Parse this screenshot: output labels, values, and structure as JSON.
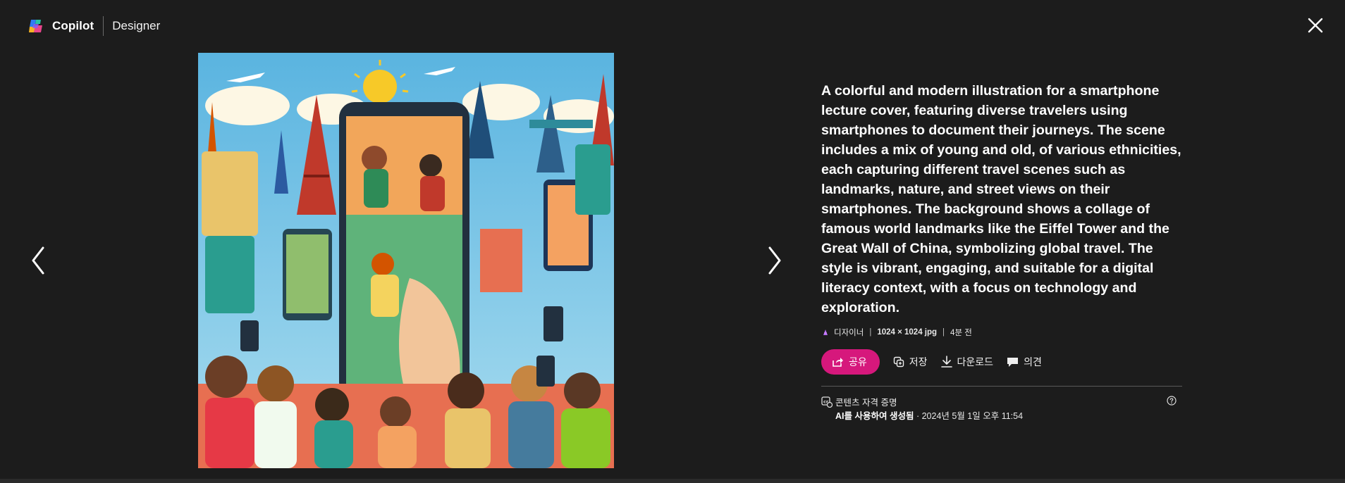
{
  "header": {
    "brand_name": "Copilot",
    "brand_sub": "Designer"
  },
  "details": {
    "prompt": "A colorful and modern illustration for a smartphone lecture cover, featuring diverse travelers using smartphones to document their journeys. The scene includes a mix of young and old, of various ethnicities, each capturing different travel scenes such as landmarks, nature, and street views on their smartphones. The background shows a collage of famous world landmarks like the Eiffel Tower and the Great Wall of China, symbolizing global travel. The style is vibrant, engaging, and suitable for a digital literacy context, with a focus on technology and exploration.",
    "meta": {
      "source": "디자이너",
      "divider": "|",
      "size": "1024 × 1024 jpg",
      "age": "4분 전"
    }
  },
  "actions": {
    "share": "공유",
    "save": "저장",
    "download": "다운로드",
    "feedback": "의견"
  },
  "credentials": {
    "title": "콘텐츠 자격 증명",
    "generated": "AI를 사용하여 생성됨",
    "separator": "·",
    "timestamp": "2024년 5월 1일 오후 11:54"
  },
  "colors": {
    "background": "#1c1c1c",
    "share_accent": "#d6187c",
    "text": "#ffffff"
  },
  "icons": {
    "close": "close-icon",
    "prev": "chevron-left-icon",
    "next": "chevron-right-icon",
    "share": "share-icon",
    "save": "save-collection-icon",
    "download": "download-icon",
    "feedback": "feedback-icon",
    "credentials": "content-credentials-icon",
    "help": "help-icon"
  }
}
